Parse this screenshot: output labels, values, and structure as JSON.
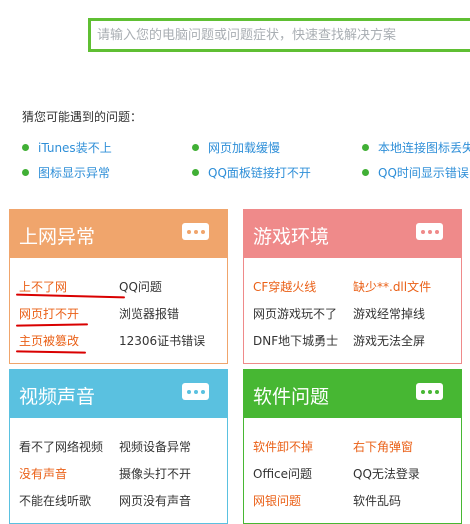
{
  "search": {
    "placeholder": "请输入您的电脑问题或问题症状，快速查找解决方案"
  },
  "guess": {
    "title": "猜您可能遇到的问题：",
    "items": [
      "iTunes装不上",
      "网页加载缓慢",
      "本地连接图标丢失",
      "图标显示异常",
      "QQ面板链接打不开",
      "QQ时间显示错误"
    ]
  },
  "cards": [
    {
      "title": "上网异常",
      "color": "#f0a56c",
      "links": [
        "上不了网",
        "QQ问题",
        "网页打不开",
        "浏览器报错",
        "主页被篡改",
        "12306证书错误"
      ]
    },
    {
      "title": "游戏环境",
      "color": "#ef8a8a",
      "links": [
        "CF穿越火线",
        "缺少**.dll文件",
        "网页游戏玩不了",
        "游戏经常掉线",
        "DNF地下城勇士",
        "游戏无法全屏"
      ]
    },
    {
      "title": "视频声音",
      "color": "#5ac1e0",
      "links": [
        "看不了网络视频",
        "视频设备异常",
        "没有声音",
        "摄像头打不开",
        "不能在线听歌",
        "网页没有声音"
      ]
    },
    {
      "title": "软件问题",
      "color": "#47b733",
      "links": [
        "软件卸不掉",
        "右下角弹窗",
        "Office问题",
        "QQ无法登录",
        "网银问题",
        "软件乱码"
      ]
    }
  ]
}
